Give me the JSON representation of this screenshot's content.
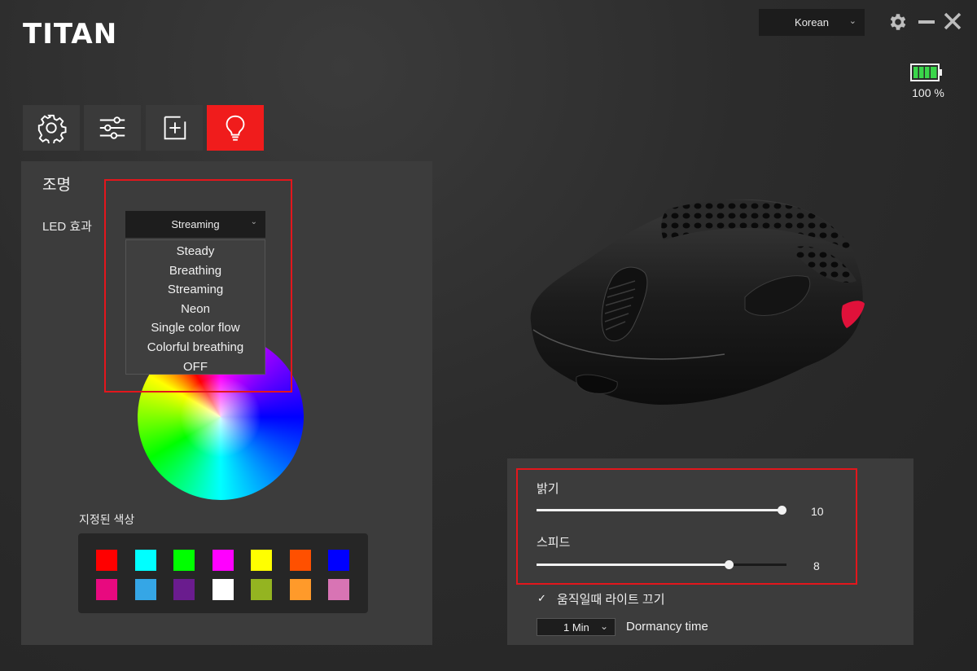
{
  "app": {
    "logo": "TITAN"
  },
  "titlebar": {
    "language": "Korean"
  },
  "battery": {
    "level_percent": 100,
    "label": "100 %"
  },
  "tabs": [
    {
      "name": "settings",
      "icon": "gear-icon",
      "active": false
    },
    {
      "name": "adjust",
      "icon": "sliders-icon",
      "active": false
    },
    {
      "name": "macro",
      "icon": "plus-box-icon",
      "active": false
    },
    {
      "name": "lighting",
      "icon": "lightbulb-icon",
      "active": true
    }
  ],
  "lighting": {
    "title": "조명",
    "led_effect_label": "LED 효과",
    "led_effect_value": "Streaming",
    "led_effect_options": [
      "Steady",
      "Breathing",
      "Streaming",
      "Neon",
      "Single color flow",
      "Colorful breathing",
      "OFF"
    ],
    "preset_label": "지정된 색상",
    "preset_colors": [
      "#ff0000",
      "#00ffff",
      "#00ff00",
      "#ff00ff",
      "#ffff00",
      "#ff5000",
      "#0000ff",
      "#e8097f",
      "#35a6e6",
      "#6a1c8e",
      "#ffffff",
      "#94b421",
      "#ff9a2a",
      "#d874b4"
    ]
  },
  "settings": {
    "brightness_label": "밝기",
    "brightness_value": "10",
    "brightness_fraction": 1.0,
    "speed_label": "스피드",
    "speed_value": "8",
    "speed_fraction": 0.78,
    "light_off_moving_label": "움직일때 라이트 끄기",
    "light_off_moving_checked": true,
    "dormancy_value": "1 Min",
    "dormancy_label": "Dormancy time"
  },
  "colors": {
    "accent": "#f01c1c",
    "highlight_border": "#e3161c"
  }
}
